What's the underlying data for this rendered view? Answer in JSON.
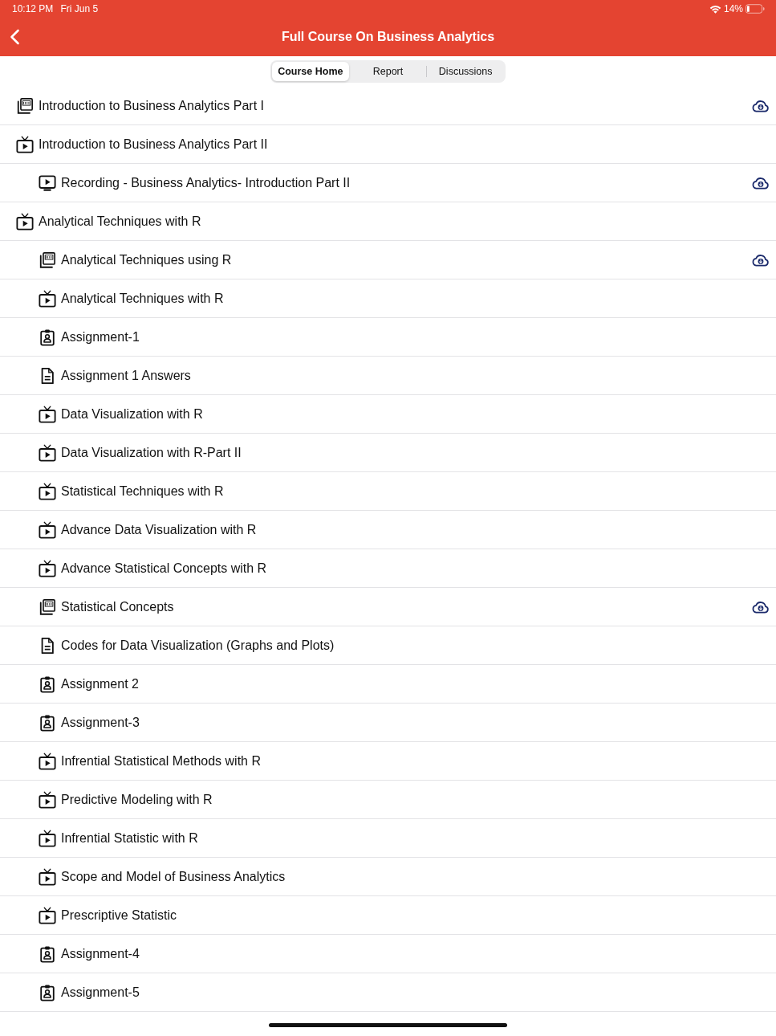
{
  "status_bar": {
    "time": "10:12 PM",
    "date": "Fri Jun 5",
    "battery": "14%"
  },
  "header": {
    "title": "Full Course On Business Analytics"
  },
  "tabs": [
    {
      "label": "Course Home",
      "selected": true
    },
    {
      "label": "Report",
      "selected": false
    },
    {
      "label": "Discussions",
      "selected": false
    }
  ],
  "items": [
    {
      "kind": "pdf",
      "title": "Introduction to Business Analytics Part I",
      "download": true
    },
    {
      "kind": "video",
      "title": "Introduction to Business Analytics Part II",
      "download": false,
      "children": [
        {
          "kind": "recording",
          "title": "Recording - Business Analytics- Introduction Part II",
          "download": true
        }
      ]
    },
    {
      "kind": "video",
      "title": "Analytical Techniques with R",
      "download": false,
      "children": [
        {
          "kind": "pdf",
          "title": "Analytical Techniques using R",
          "download": true
        },
        {
          "kind": "video",
          "title": "Analytical Techniques with R",
          "download": false
        },
        {
          "kind": "assignment",
          "title": "Assignment-1",
          "download": false
        },
        {
          "kind": "document",
          "title": "Assignment 1 Answers",
          "download": false
        },
        {
          "kind": "video",
          "title": "Data Visualization with R",
          "download": false
        },
        {
          "kind": "video",
          "title": "Data Visualization with R-Part II",
          "download": false
        },
        {
          "kind": "video",
          "title": "Statistical Techniques with R",
          "download": false
        },
        {
          "kind": "video",
          "title": "Advance Data Visualization with R",
          "download": false
        },
        {
          "kind": "video",
          "title": "Advance Statistical Concepts with R",
          "download": false
        },
        {
          "kind": "pdf",
          "title": "Statistical Concepts",
          "download": true
        },
        {
          "kind": "document",
          "title": "Codes for Data Visualization (Graphs and Plots)",
          "download": false
        },
        {
          "kind": "assignment",
          "title": "Assignment 2",
          "download": false
        },
        {
          "kind": "assignment",
          "title": "Assignment-3",
          "download": false
        },
        {
          "kind": "video",
          "title": "Infrential Statistical Methods with R",
          "download": false
        },
        {
          "kind": "video",
          "title": "Predictive Modeling with R",
          "download": false
        },
        {
          "kind": "video",
          "title": "Infrential Statistic with R",
          "download": false
        },
        {
          "kind": "video",
          "title": "Scope and Model of Business Analytics",
          "download": false
        },
        {
          "kind": "video",
          "title": "Prescriptive Statistic",
          "download": false
        },
        {
          "kind": "assignment",
          "title": "Assignment-4",
          "download": false
        },
        {
          "kind": "assignment",
          "title": "Assignment-5",
          "download": false
        }
      ]
    }
  ]
}
